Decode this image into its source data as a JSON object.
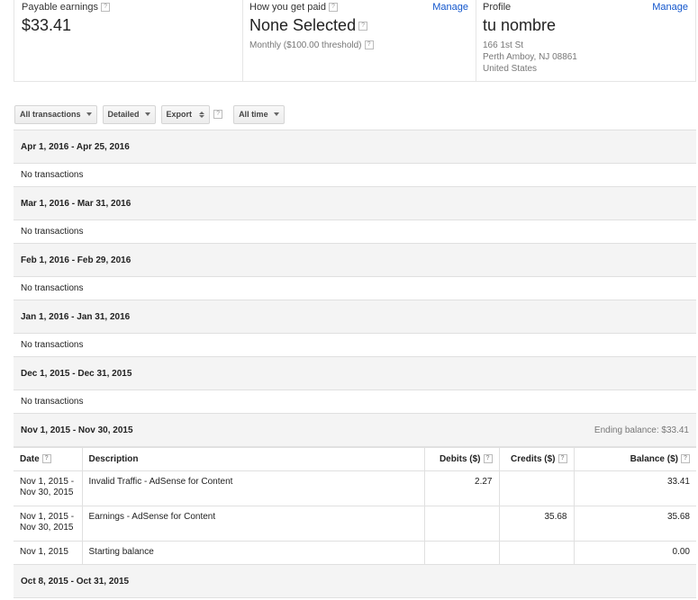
{
  "summary": {
    "payable": {
      "label": "Payable earnings",
      "value": "$33.41"
    },
    "payment": {
      "label": "How you get paid",
      "manage": "Manage",
      "value": "None Selected",
      "sub": "Monthly ($100.00 threshold)"
    },
    "profile": {
      "label": "Profile",
      "manage": "Manage",
      "value": "tu nombre",
      "address": [
        "166 1st St",
        "Perth Amboy, NJ 08861",
        "United States"
      ]
    }
  },
  "help_glyph": "?",
  "toolbar": {
    "transactions": "All transactions",
    "detail": "Detailed",
    "export": "Export",
    "range": "All time"
  },
  "periods": [
    {
      "title": "Apr 1, 2016 - Apr 25, 2016",
      "empty": "No transactions"
    },
    {
      "title": "Mar 1, 2016 - Mar 31, 2016",
      "empty": "No transactions"
    },
    {
      "title": "Feb 1, 2016 - Feb 29, 2016",
      "empty": "No transactions"
    },
    {
      "title": "Jan 1, 2016 - Jan 31, 2016",
      "empty": "No transactions"
    },
    {
      "title": "Dec 1, 2015 - Dec 31, 2015",
      "empty": "No transactions"
    },
    {
      "title": "Nov 1, 2015 - Nov 30, 2015",
      "ending": "Ending balance: $33.41"
    },
    {
      "title": "Oct 8, 2015 - Oct 31, 2015"
    }
  ],
  "table": {
    "columns": [
      "Date",
      "Description",
      "Debits ($)",
      "Credits ($)",
      "Balance ($)"
    ],
    "rows": [
      {
        "date": "Nov 1, 2015 - Nov 30, 2015",
        "description": "Invalid Traffic - AdSense for Content",
        "debit": "2.27",
        "credit": "",
        "balance": "33.41"
      },
      {
        "date": "Nov 1, 2015 - Nov 30, 2015",
        "description": "Earnings - AdSense for Content",
        "debit": "",
        "credit": "35.68",
        "balance": "35.68"
      },
      {
        "date": "Nov 1, 2015",
        "description": "Starting balance",
        "debit": "",
        "credit": "",
        "balance": "0.00"
      }
    ]
  }
}
